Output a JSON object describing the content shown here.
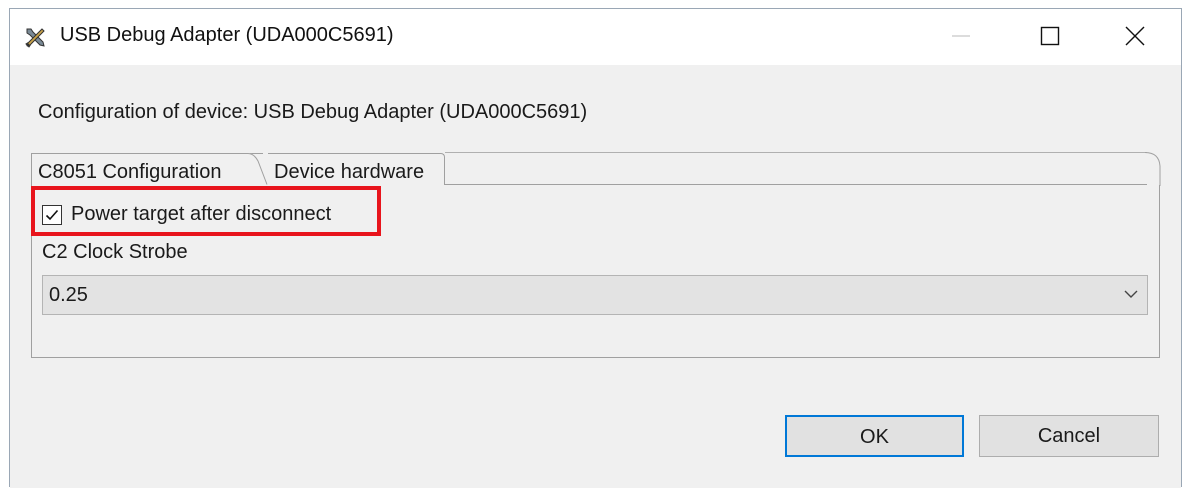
{
  "window": {
    "title": "USB Debug Adapter (UDA000C5691)",
    "icon": "tools-icon"
  },
  "dialog": {
    "config_label": "Configuration of device: USB Debug Adapter (UDA000C5691)",
    "tabs": [
      {
        "label": "C8051 Configuration",
        "active": true
      },
      {
        "label": "Device hardware",
        "active": false
      }
    ],
    "power_checkbox": {
      "label": "Power target after disconnect",
      "checked": true
    },
    "clock_strobe": {
      "label": "C2 Clock Strobe",
      "value": "0.25"
    },
    "buttons": {
      "ok": "OK",
      "cancel": "Cancel"
    }
  },
  "colors": {
    "highlight": "#e8141c",
    "default_button_border": "#0078d7"
  }
}
